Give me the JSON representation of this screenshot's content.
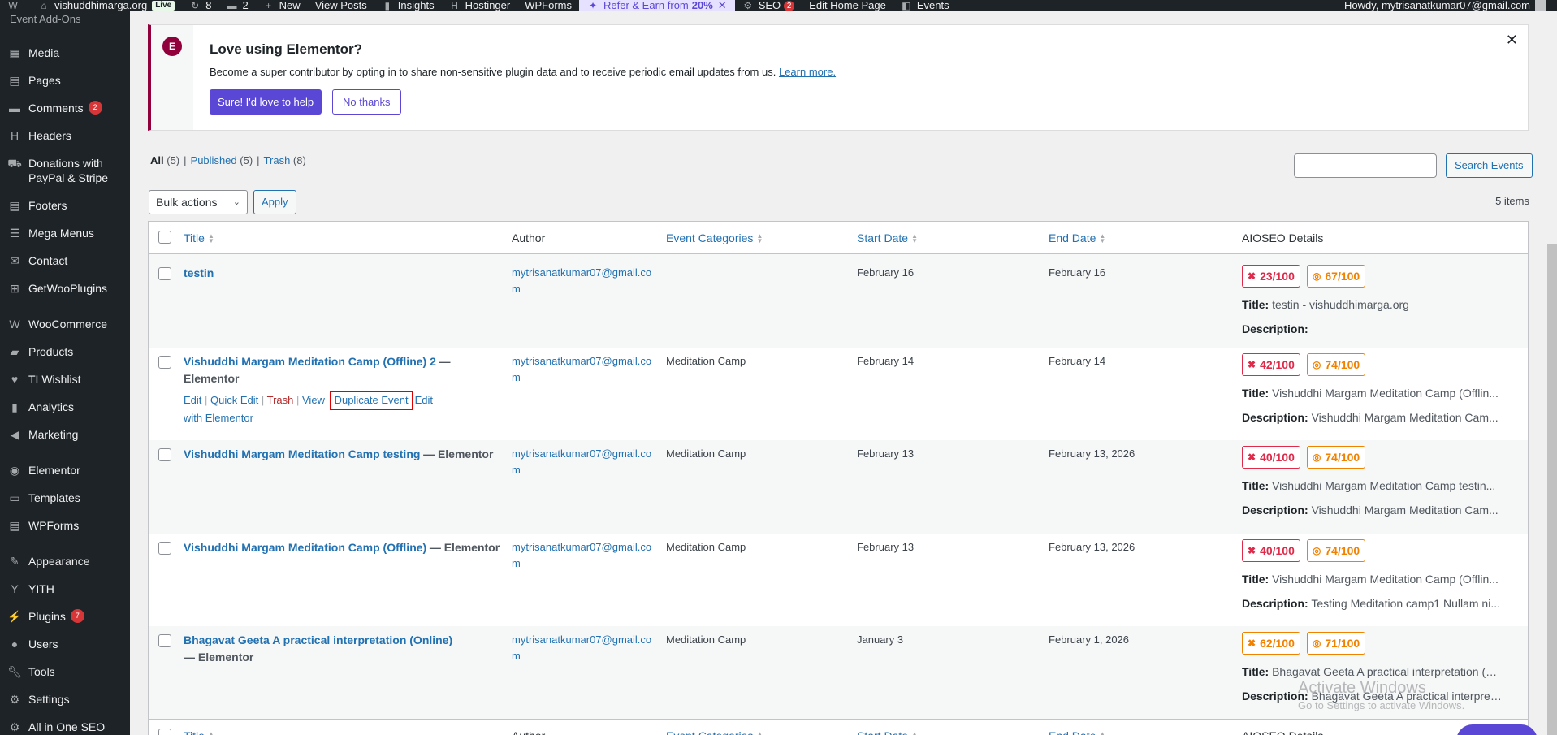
{
  "admin_bar": {
    "site_name": "vishuddhimarga.org",
    "live": "Live",
    "updates_count": "8",
    "comments_count": "2",
    "new": "New",
    "view_posts": "View Posts",
    "insights": "Insights",
    "hostinger": "Hostinger",
    "wpforms": "WPForms",
    "refer_text": "Refer & Earn from",
    "refer_pct": "20%",
    "seo": "SEO",
    "seo_badge": "2",
    "edit_home": "Edit Home Page",
    "events": "Events",
    "howdy": "Howdy, mytrisanatkumar07@gmail.com"
  },
  "sidebar": {
    "cut_label": "Event Add-Ons",
    "items": [
      {
        "label": "Media",
        "icon": "media-icon"
      },
      {
        "label": "Pages",
        "icon": "pages-icon"
      },
      {
        "label": "Comments",
        "icon": "comments-icon",
        "badge": "2"
      },
      {
        "label": "Headers",
        "icon": "headers-icon"
      },
      {
        "label": "Donations with PayPal & Stripe",
        "icon": "donations-icon"
      },
      {
        "label": "Footers",
        "icon": "footers-icon"
      },
      {
        "label": "Mega Menus",
        "icon": "mega-menus-icon"
      },
      {
        "label": "Contact",
        "icon": "contact-icon"
      },
      {
        "label": "GetWooPlugins",
        "icon": "getwooplugins-icon"
      },
      {
        "label": "WooCommerce",
        "icon": "woocommerce-icon"
      },
      {
        "label": "Products",
        "icon": "products-icon"
      },
      {
        "label": "TI Wishlist",
        "icon": "wishlist-icon"
      },
      {
        "label": "Analytics",
        "icon": "analytics-icon"
      },
      {
        "label": "Marketing",
        "icon": "marketing-icon"
      },
      {
        "label": "Elementor",
        "icon": "elementor-icon"
      },
      {
        "label": "Templates",
        "icon": "templates-icon"
      },
      {
        "label": "WPForms",
        "icon": "wpforms-icon"
      },
      {
        "label": "Appearance",
        "icon": "appearance-icon"
      },
      {
        "label": "YITH",
        "icon": "yith-icon"
      },
      {
        "label": "Plugins",
        "icon": "plugins-icon",
        "badge": "7"
      },
      {
        "label": "Users",
        "icon": "users-icon"
      },
      {
        "label": "Tools",
        "icon": "tools-icon"
      },
      {
        "label": "Settings",
        "icon": "settings-icon"
      },
      {
        "label": "All in One SEO",
        "icon": "aioseo-icon"
      }
    ]
  },
  "notice": {
    "title": "Love using Elementor?",
    "text": "Become a super contributor by opting in to share non-sensitive plugin data and to receive periodic email updates from us.",
    "learn_more": "Learn more.",
    "primary": "Sure! I'd love to help",
    "secondary": "No thanks"
  },
  "filters": {
    "all": "All",
    "all_count": "(5)",
    "published": "Published",
    "published_count": "(5)",
    "trash": "Trash",
    "trash_count": "(8)"
  },
  "search": {
    "button": "Search Events",
    "placeholder": ""
  },
  "bulk": {
    "label": "Bulk actions",
    "apply": "Apply"
  },
  "items_count": "5 items",
  "table": {
    "columns": {
      "title": "Title",
      "author": "Author",
      "categories": "Event Categories",
      "start": "Start Date",
      "end": "End Date",
      "aioseo": "AIOSEO Details"
    },
    "row_actions": {
      "edit": "Edit",
      "quick_edit": "Quick Edit",
      "trash": "Trash",
      "view": "View",
      "duplicate": "Duplicate Event",
      "edit_with": "Edit with Elementor"
    },
    "title_label": "Title:",
    "desc_label": "Description:",
    "rows": [
      {
        "title": "testin",
        "state": "",
        "author": "mytrisanatkumar07@gmail.com",
        "category": "",
        "start": "February 16",
        "end": "February 16",
        "score1": "23/100",
        "score2": "67/100",
        "score1_color": "red",
        "seo_title": "testin - vishuddhimarga.org",
        "seo_desc": ""
      },
      {
        "title": "Vishuddhi Margam Meditation Camp (Offline) 2",
        "state": "— Elementor",
        "author": "mytrisanatkumar07@gmail.com",
        "category": "Meditation Camp",
        "start": "February 14",
        "end": "February 14",
        "score1": "42/100",
        "score2": "74/100",
        "score1_color": "red",
        "seo_title": "Vishuddhi Margam Meditation Camp (Offlin...",
        "seo_desc": "Vishuddhi Margam Meditation Cam..."
      },
      {
        "title": "Vishuddhi Margam Meditation Camp testing",
        "state": "— Elementor",
        "author": "mytrisanatkumar07@gmail.com",
        "category": "Meditation Camp",
        "start": "February 13",
        "end": "February 13, 2026",
        "score1": "40/100",
        "score2": "74/100",
        "score1_color": "red",
        "seo_title": "Vishuddhi Margam Meditation Camp testin...",
        "seo_desc": "Vishuddhi Margam Meditation Cam..."
      },
      {
        "title": "Vishuddhi Margam Meditation Camp (Offline)",
        "state": "— Elementor",
        "author": "mytrisanatkumar07@gmail.com",
        "category": "Meditation Camp",
        "start": "February 13",
        "end": "February 13, 2026",
        "score1": "40/100",
        "score2": "74/100",
        "score1_color": "red",
        "seo_title": "Vishuddhi Margam Meditation Camp (Offlin...",
        "seo_desc": "Testing Meditation camp1 Nullam ni..."
      },
      {
        "title": "Bhagavat Geeta A practical interpretation (Online)",
        "state": "— Elementor",
        "author": "mytrisanatkumar07@gmail.com",
        "category": "Meditation Camp",
        "start": "January 3",
        "end": "February 1, 2026",
        "score1": "62/100",
        "score2": "71/100",
        "score1_color": "orange",
        "seo_title": "Bhagavat Geeta A practical interpretation (O...",
        "seo_desc": "Bhagavat Geeta A practical interpret..."
      }
    ]
  },
  "watermark": {
    "line1": "Activate Windows",
    "line2": "Go to Settings to activate Windows."
  },
  "colors": {
    "admin_bar": "#1d2327",
    "link": "#2271b1",
    "elementor": "#92003b",
    "accent": "#5b47d6",
    "score_red": "#df2a4a",
    "score_orange": "#f18200"
  }
}
